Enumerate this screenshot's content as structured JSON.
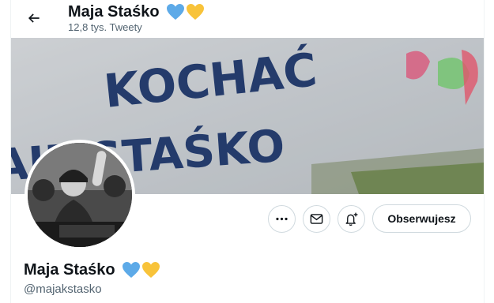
{
  "header": {
    "name": "Maja Staśko",
    "tweet_count": "12,8 tys. Tweety",
    "emoji": [
      "blue-heart",
      "yellow-heart"
    ]
  },
  "banner": {
    "graffiti_line1": "KOCHAĆ",
    "graffiti_line2": "AJE STAŚKO"
  },
  "actions": {
    "follow_label": "Obserwujesz"
  },
  "profile": {
    "name": "Maja Staśko",
    "handle": "@majakstasko"
  },
  "colors": {
    "blue_heart": "#5daae8",
    "yellow_heart": "#f8c33a",
    "secondary_text": "#536471",
    "border": "#cfd9de"
  }
}
